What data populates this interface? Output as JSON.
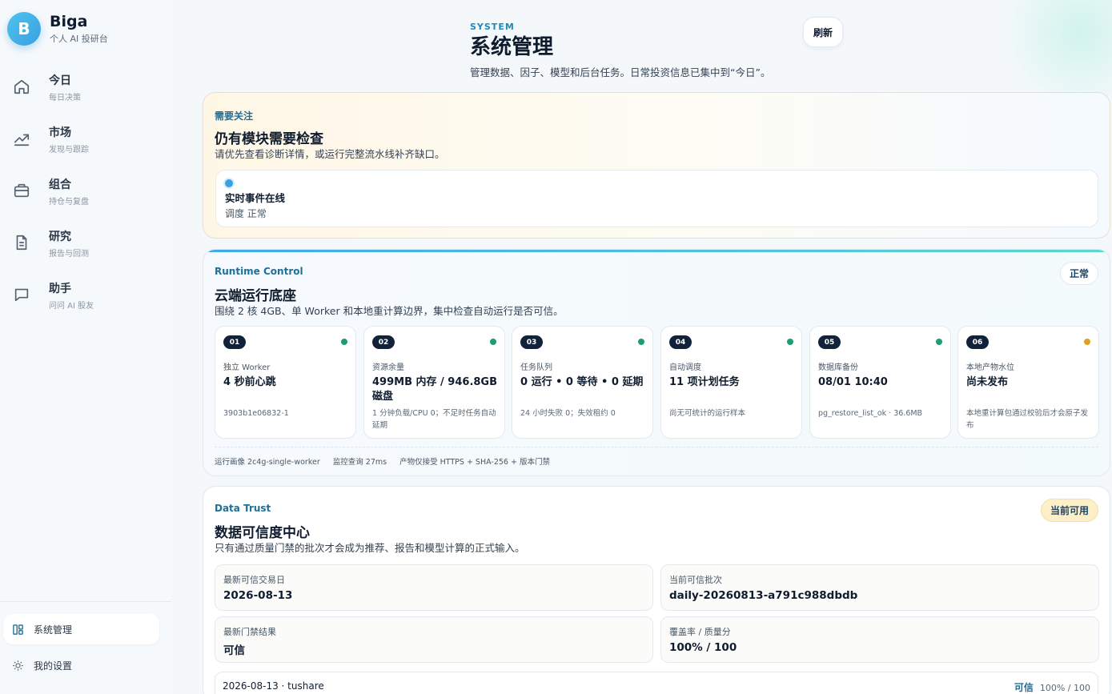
{
  "brand": {
    "logo_letter": "B",
    "name": "Biga",
    "subtitle": "个人 AI 投研台"
  },
  "nav": [
    {
      "label": "今日",
      "sub": "每日决策",
      "icon": "home-icon"
    },
    {
      "label": "市场",
      "sub": "发现与跟踪",
      "icon": "trend-icon"
    },
    {
      "label": "组合",
      "sub": "持仓与复盘",
      "icon": "briefcase-icon"
    },
    {
      "label": "研究",
      "sub": "报告与回测",
      "icon": "document-icon"
    },
    {
      "label": "助手",
      "sub": "问问 AI 股友",
      "icon": "chat-icon"
    }
  ],
  "bottom_nav": [
    {
      "label": "系统管理",
      "icon": "dashboard-icon",
      "active": true
    },
    {
      "label": "我的设置",
      "icon": "settings-icon",
      "active": false
    }
  ],
  "header": {
    "eyebrow": "SYSTEM",
    "title": "系统管理",
    "description": "管理数据、因子、模型和后台任务。日常投资信息已集中到“今日”。",
    "refresh_label": "刷新"
  },
  "attention": {
    "kicker": "需要关注",
    "title": "仍有模块需要检查",
    "description": "请优先查看诊断详情，或运行完整流水线补齐缺口。",
    "event": {
      "title": "实时事件在线",
      "status": "调度 正常"
    }
  },
  "runtime": {
    "kicker": "Runtime Control",
    "title": "云端运行底座",
    "description": "围绕 2 核 4GB、单 Worker 和本地重计算边界，集中检查自动运行是否可信。",
    "status": "正常",
    "modules": [
      {
        "num": "01",
        "label": "独立 Worker",
        "value": "4 秒前心跳",
        "note": "3903b1e06832-1",
        "status_color": "#1f9d6e"
      },
      {
        "num": "02",
        "label": "资源余量",
        "value": "499MB 内存 / 946.8GB 磁盘",
        "note": "1 分钟负载/CPU 0；不足时任务自动延期",
        "status_color": "#1f9d6e"
      },
      {
        "num": "03",
        "label": "任务队列",
        "value": "0 运行 • 0 等待 • 0 延期",
        "note": "24 小时失败 0；失效租约 0",
        "status_color": "#1f9d6e"
      },
      {
        "num": "04",
        "label": "自动调度",
        "value": "11 项计划任务",
        "note": "尚无可统计的运行样本",
        "status_color": "#1f9d6e"
      },
      {
        "num": "05",
        "label": "数据库备份",
        "value": "08/01 10:40",
        "note": "pg_restore_list_ok · 36.6MB",
        "status_color": "#1f9d6e"
      },
      {
        "num": "06",
        "label": "本地产物水位",
        "value": "尚未发布",
        "note": "本地重计算包通过校验后才会原子发布",
        "status_color": "#e0a020"
      }
    ],
    "footer": [
      "运行画像 2c4g-single-worker",
      "监控查询 27ms",
      "产物仅接受 HTTPS + SHA-256 + 版本门禁"
    ]
  },
  "trust": {
    "kicker": "Data Trust",
    "title": "数据可信度中心",
    "description": "只有通过质量门禁的批次才会成为推荐、报告和模型计算的正式输入。",
    "status": "当前可用",
    "fields": [
      {
        "label": "最新可信交易日",
        "value": "2026-08-13"
      },
      {
        "label": "当前可信批次",
        "value": "daily-20260813-a791c988dbdb"
      },
      {
        "label": "最新门禁结果",
        "value": "可信"
      },
      {
        "label": "覆盖率 / 质量分",
        "value": "100% / 100"
      }
    ],
    "batch": {
      "left": "2026-08-13 · tushare",
      "status": "可信",
      "score": "100% / 100"
    }
  }
}
